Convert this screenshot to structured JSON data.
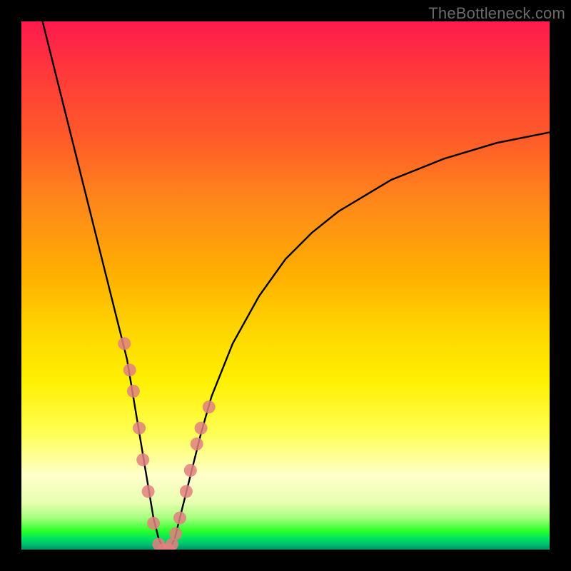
{
  "watermark": "TheBottleneck.com",
  "chart_data": {
    "type": "line",
    "title": "",
    "xlabel": "",
    "ylabel": "",
    "xlim": [
      0,
      100
    ],
    "ylim": [
      0,
      100
    ],
    "legend": false,
    "grid": false,
    "series": [
      {
        "name": "bottleneck-curve",
        "color": "#000000",
        "x": [
          4,
          6,
          8,
          10,
          12,
          14,
          16,
          18,
          20,
          22,
          23,
          24,
          25,
          26,
          27,
          28,
          29,
          30,
          32,
          34,
          36,
          40,
          45,
          50,
          55,
          60,
          65,
          70,
          75,
          80,
          85,
          90,
          95,
          100
        ],
        "y": [
          100,
          92,
          84,
          76,
          68,
          60,
          52,
          44,
          36,
          24,
          18,
          12,
          6,
          2,
          0,
          0,
          2,
          6,
          14,
          22,
          29,
          39,
          48,
          55,
          60,
          64,
          67,
          70,
          72,
          74,
          75.5,
          77,
          78,
          79
        ]
      }
    ],
    "markers": [
      {
        "name": "highlight-dots",
        "color": "#e08080",
        "radius_px": 9,
        "x": [
          19.5,
          20.5,
          21.2,
          22.3,
          23.0,
          24.0,
          25.0,
          26.0,
          27.0,
          27.8,
          28.5,
          29.2,
          30.0,
          31.2,
          32.0,
          33.2,
          34.0,
          35.5
        ],
        "y": [
          39,
          34,
          30,
          23,
          17,
          11,
          5,
          1,
          0,
          0,
          1,
          3,
          6,
          11,
          15,
          20,
          23,
          27
        ]
      }
    ]
  }
}
